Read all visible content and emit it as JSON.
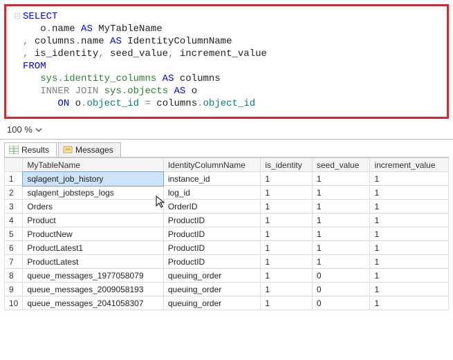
{
  "sql": {
    "l1_kw": "SELECT",
    "l2_indent": "   ",
    "l2_a": "o",
    "l2_dot": ".",
    "l2_b": "name",
    "l2_c": " AS ",
    "l2_d": "MyTableName",
    "l3_prefix": ", ",
    "l3_a": "columns",
    "l3_b": "name",
    "l3_c": " AS ",
    "l3_d": "IdentityColumnName",
    "l4_prefix": ", ",
    "l4_a": "is_identity",
    "l4_comma1": ", ",
    "l4_b": "seed_value",
    "l4_comma2": ", ",
    "l4_c": "increment_value",
    "l5_kw": "FROM",
    "l6_indent": "   ",
    "l6_a": "sys",
    "l6_b": "identity_columns",
    "l6_c": " AS ",
    "l6_d": "columns",
    "l7_indent": "   ",
    "l7_a": "INNER",
    "l7_b": " JOIN ",
    "l7_c": "sys",
    "l7_d": "objects",
    "l7_e": " AS ",
    "l7_f": "o",
    "l8_indent": "      ",
    "l8_a": "ON ",
    "l8_b": "o",
    "l8_c": "object_id",
    "l8_d": " ",
    "l8_e": "=",
    "l8_f": " ",
    "l8_g": "columns",
    "l8_h": "object_id"
  },
  "zoom": {
    "value": "100 %"
  },
  "tabs": {
    "results": "Results",
    "messages": "Messages"
  },
  "columns": {
    "c_blank": "",
    "c1": "MyTableName",
    "c2": "IdentityColumnName",
    "c3": "is_identity",
    "c4": "seed_value",
    "c5": "increment_value"
  },
  "rows": {
    "r0": {
      "n": "1",
      "a": "sqlagent_job_history",
      "b": "instance_id",
      "c": "1",
      "d": "1",
      "e": "1"
    },
    "r1": {
      "n": "2",
      "a": "sqlagent_jobsteps_logs",
      "b": "log_id",
      "c": "1",
      "d": "1",
      "e": "1"
    },
    "r2": {
      "n": "3",
      "a": "Orders",
      "b": "OrderID",
      "c": "1",
      "d": "1",
      "e": "1"
    },
    "r3": {
      "n": "4",
      "a": "Product",
      "b": "ProductID",
      "c": "1",
      "d": "1",
      "e": "1"
    },
    "r4": {
      "n": "5",
      "a": "ProductNew",
      "b": "ProductID",
      "c": "1",
      "d": "1",
      "e": "1"
    },
    "r5": {
      "n": "6",
      "a": "ProductLatest1",
      "b": "ProductID",
      "c": "1",
      "d": "1",
      "e": "1"
    },
    "r6": {
      "n": "7",
      "a": "ProductLatest",
      "b": "ProductID",
      "c": "1",
      "d": "1",
      "e": "1"
    },
    "r7": {
      "n": "8",
      "a": "queue_messages_1977058079",
      "b": "queuing_order",
      "c": "1",
      "d": "0",
      "e": "1"
    },
    "r8": {
      "n": "9",
      "a": "queue_messages_2009058193",
      "b": "queuing_order",
      "c": "1",
      "d": "0",
      "e": "1"
    },
    "r9": {
      "n": "10",
      "a": "queue_messages_2041058307",
      "b": "queuing_order",
      "c": "1",
      "d": "0",
      "e": "1"
    }
  }
}
